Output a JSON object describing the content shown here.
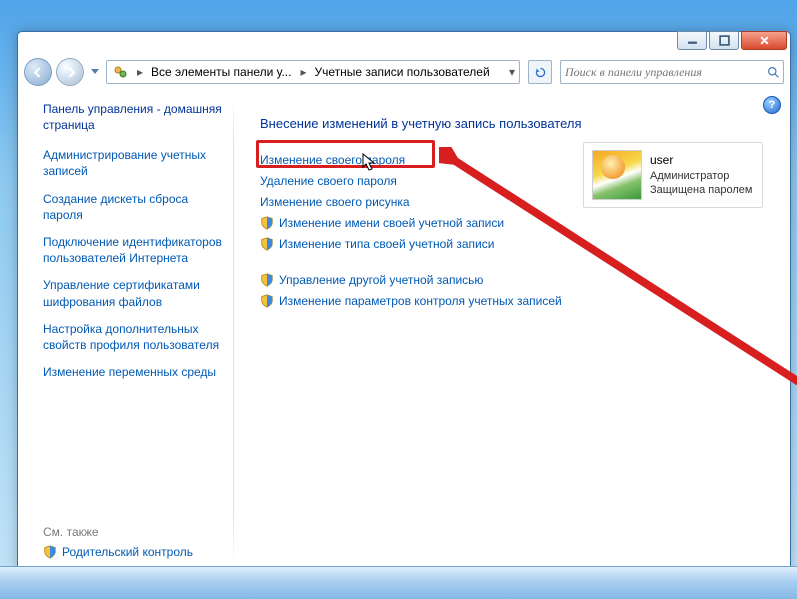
{
  "titlebar": {},
  "nav": {
    "breadcrumb": {
      "seg1": "Все элементы панели у...",
      "seg2": "Учетные записи пользователей"
    },
    "search_placeholder": "Поиск в панели управления"
  },
  "sidebar": {
    "home": "Панель управления - домашняя страница",
    "links": [
      "Администрирование учетных записей",
      "Создание дискеты сброса пароля",
      "Подключение идентификаторов пользователей Интернета",
      "Управление сертификатами шифрования файлов",
      "Настройка дополнительных свойств профиля пользователя",
      "Изменение переменных среды"
    ],
    "see_also": "См. также",
    "footer_link": "Родительский контроль"
  },
  "main": {
    "heading": "Внесение изменений в учетную запись пользователя",
    "actions_top": [
      {
        "label": "Изменение своего пароля",
        "shield": false,
        "highlighted": true
      },
      {
        "label": "Удаление своего пароля",
        "shield": false,
        "highlighted": false
      },
      {
        "label": "Изменение своего рисунка",
        "shield": false,
        "highlighted": false
      },
      {
        "label": "Изменение имени своей учетной записи",
        "shield": true,
        "highlighted": false
      },
      {
        "label": "Изменение типа своей учетной записи",
        "shield": true,
        "highlighted": false
      }
    ],
    "actions_bottom": [
      {
        "label": "Управление другой учетной записью",
        "shield": true
      },
      {
        "label": "Изменение параметров контроля учетных записей",
        "shield": true
      }
    ],
    "user": {
      "name": "user",
      "role": "Администратор",
      "status": "Защищена паролем"
    }
  }
}
